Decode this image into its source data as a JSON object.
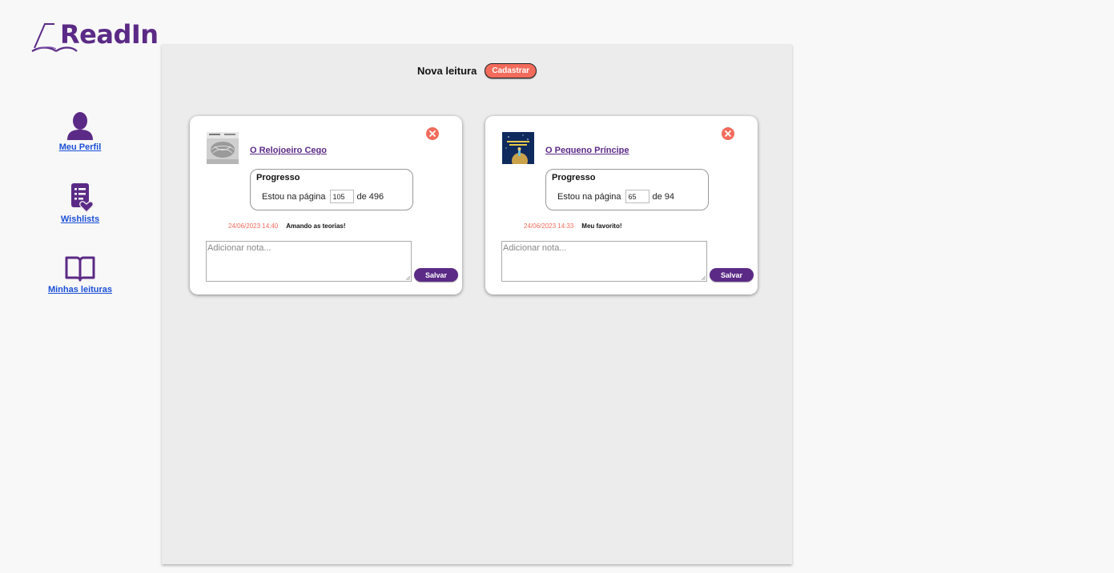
{
  "app": {
    "logo_text": "ReadIn"
  },
  "sidebar": {
    "items": [
      {
        "label": "Meu Perfil",
        "icon": "user-icon"
      },
      {
        "label": "Wishlists",
        "icon": "list-heart-icon"
      },
      {
        "label": "Minhas leituras",
        "icon": "open-book-icon"
      }
    ]
  },
  "main": {
    "new_reading_label": "Nova leitura",
    "register_button": "Cadastrar",
    "cards": [
      {
        "title": "O Relojoeiro Cego",
        "cover_icon": "book-cover-relojoeiro",
        "progress_title": "Progresso",
        "progress_prefix": "Estou na página",
        "current_page": "105",
        "total_label": "de 496",
        "note_date": "24/06/2023 14:40",
        "note_text": "Amando as teorias!",
        "note_placeholder": "Adicionar nota...",
        "save_button": "Salvar"
      },
      {
        "title": "O Pequeno Príncipe",
        "cover_icon": "book-cover-pequeno-principe",
        "progress_title": "Progresso",
        "progress_prefix": "Estou na página",
        "current_page": "65",
        "total_label": "de 94",
        "note_date": "24/06/2023 14:33",
        "note_text": "Meu favorito!",
        "note_placeholder": "Adicionar nota...",
        "save_button": "Salvar"
      }
    ]
  },
  "colors": {
    "brand": "#5b2a86",
    "accent": "#f26b5b",
    "link": "#1a4fd8",
    "panel": "#ececec"
  }
}
